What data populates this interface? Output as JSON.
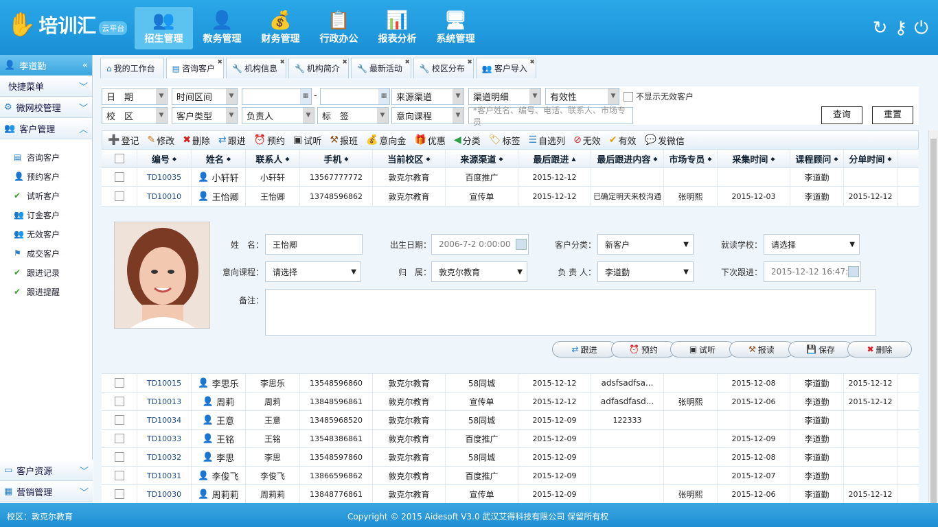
{
  "app": {
    "name": "培训汇",
    "cloud": "云平台"
  },
  "nav": [
    {
      "label": "招生管理",
      "icon": "👥"
    },
    {
      "label": "教务管理",
      "icon": "👤"
    },
    {
      "label": "财务管理",
      "icon": "💰"
    },
    {
      "label": "行政办公",
      "icon": "📋"
    },
    {
      "label": "报表分析",
      "icon": "📊"
    },
    {
      "label": "系统管理",
      "icon": "🖥"
    }
  ],
  "header_icons": [
    "refresh-icon",
    "key-icon",
    "power-icon"
  ],
  "sidebar": {
    "user": "李道勤",
    "sections": [
      {
        "label": "快捷菜单"
      },
      {
        "label": "微网校管理"
      },
      {
        "label": "客户管理"
      }
    ],
    "items": [
      {
        "label": "咨询客户"
      },
      {
        "label": "预约客户"
      },
      {
        "label": "试听客户"
      },
      {
        "label": "订金客户"
      },
      {
        "label": "无效客户"
      },
      {
        "label": "成交客户"
      },
      {
        "label": "跟进记录"
      },
      {
        "label": "跟进提醒"
      }
    ],
    "bottom": [
      {
        "label": "客户资源"
      },
      {
        "label": "营销管理"
      }
    ]
  },
  "tabs": [
    {
      "label": "我的工作台"
    },
    {
      "label": "咨询客户"
    },
    {
      "label": "机构信息"
    },
    {
      "label": "机构简介"
    },
    {
      "label": "最新活动"
    },
    {
      "label": "校区分布"
    },
    {
      "label": "客户导入"
    }
  ],
  "filters": {
    "date": "日　期",
    "period": "时间区间",
    "dash": "-",
    "source": "来源渠道",
    "detail": "渠道明细",
    "valid": "有效性",
    "hide_invalid": "不显示无效客户",
    "campus": "校　区",
    "ctype": "客户类型",
    "owner": "负责人",
    "tag": "标　签",
    "course": "意向课程",
    "search_placeholder": "*客户姓名、编号、电话、联系人、市场专员",
    "query": "查询",
    "reset": "重置"
  },
  "toolbar": [
    {
      "label": "登记",
      "i": "➕"
    },
    {
      "label": "修改",
      "i": "✎"
    },
    {
      "label": "删除",
      "i": "✖"
    },
    {
      "label": "跟进",
      "i": "⇄"
    },
    {
      "label": "预约",
      "i": "⏰"
    },
    {
      "label": "试听",
      "i": "▣"
    },
    {
      "label": "报班",
      "i": "⚒"
    },
    {
      "label": "意向金",
      "i": "💰"
    },
    {
      "label": "优惠",
      "i": "🎁"
    },
    {
      "label": "分类",
      "i": "◀"
    },
    {
      "label": "标签",
      "i": "🏷"
    },
    {
      "label": "自选列",
      "i": "☰"
    },
    {
      "label": "无效",
      "i": "⊘"
    },
    {
      "label": "有效",
      "i": "✔"
    },
    {
      "label": "发微信",
      "i": "💬"
    }
  ],
  "columns": [
    "编号",
    "姓名",
    "联系人",
    "手机",
    "当前校区",
    "来源渠道",
    "最后跟进",
    "最后跟进内容",
    "市场专员",
    "采集时间",
    "课程顾问",
    "分单时间"
  ],
  "rows_top": [
    [
      "TD10035",
      "小轩轩",
      "m",
      "小轩轩",
      "13567777772",
      "敦克尔教育",
      "百度推广",
      "2015-12-12",
      "",
      "",
      "",
      "李道勤",
      ""
    ],
    [
      "TD10010",
      "王怡卿",
      "f",
      "王怡卿",
      "13748596862",
      "敦克尔教育",
      "宣传单",
      "2015-12-12",
      "已确定明天来校沟通",
      "张明熙",
      "2015-12-03",
      "李道勤",
      "2015-12-12"
    ]
  ],
  "detail": {
    "name_label": "姓　名：",
    "name": "王怡卿",
    "birth_label": "出生日期：",
    "birth": "2006-7-2 0:00:00",
    "cat_label": "客户分类：",
    "cat": "新客户",
    "school_label": "就读学校：",
    "school": "请选择",
    "course_label": "意向课程：",
    "course": "请选择",
    "belong_label": "归　属：",
    "belong": "敦克尔教育",
    "owner_label": "负 责 人：",
    "owner": "李道勤",
    "next_label": "下次跟进：",
    "next": "2015-12-12 16:47:00",
    "remark_label": "备注：",
    "buttons": [
      {
        "label": "跟进",
        "i": "⇄"
      },
      {
        "label": "预约",
        "i": "⏰"
      },
      {
        "label": "试听",
        "i": "▣"
      },
      {
        "label": "报读",
        "i": "⚒"
      },
      {
        "label": "保存",
        "i": "💾"
      },
      {
        "label": "删除",
        "i": "✖"
      }
    ]
  },
  "rows_bottom": [
    [
      "TD10015",
      "李思乐",
      "m",
      "李思乐",
      "13548596860",
      "敦克尔教育",
      "58同城",
      "2015-12-12",
      "adsfsadfsa...",
      "",
      "2015-12-08",
      "李道勤",
      "2015-12-12"
    ],
    [
      "TD10013",
      "周莉",
      "f",
      "周莉",
      "13848596861",
      "敦克尔教育",
      "宣传单",
      "2015-12-12",
      "adfasdfasd...",
      "张明熙",
      "2015-12-06",
      "李道勤",
      "2015-12-12"
    ],
    [
      "TD10034",
      "王意",
      "f",
      "王意",
      "13485968520",
      "敦克尔教育",
      "58同城",
      "2015-12-09",
      "122333",
      "",
      "",
      "李道勤",
      ""
    ],
    [
      "TD10033",
      "王铭",
      "m",
      "王铭",
      "13548386861",
      "敦克尔教育",
      "百度推广",
      "2015-12-09",
      "",
      "",
      "2015-12-09",
      "李道勤",
      ""
    ],
    [
      "TD10032",
      "李思",
      "m",
      "李思",
      "13548597860",
      "敦克尔教育",
      "58同城",
      "2015-12-09",
      "",
      "",
      "2015-12-08",
      "李道勤",
      ""
    ],
    [
      "TD10031",
      "李俊飞",
      "m",
      "李俊飞",
      "13866596862",
      "敦克尔教育",
      "百度推广",
      "2015-12-09",
      "",
      "",
      "2015-12-07",
      "李道勤",
      ""
    ],
    [
      "TD10030",
      "周莉莉",
      "f",
      "周莉莉",
      "13848776861",
      "敦克尔教育",
      "宣传单",
      "2015-12-09",
      "",
      "张明熙",
      "2015-12-06",
      "李道勤",
      "2015-12-12"
    ]
  ],
  "footer": {
    "campus": "校区：敦克尔教育",
    "copyright": "Copyright © 2015 Aidesoft V3.0 武汉艾得科技有限公司 保留所有权"
  }
}
